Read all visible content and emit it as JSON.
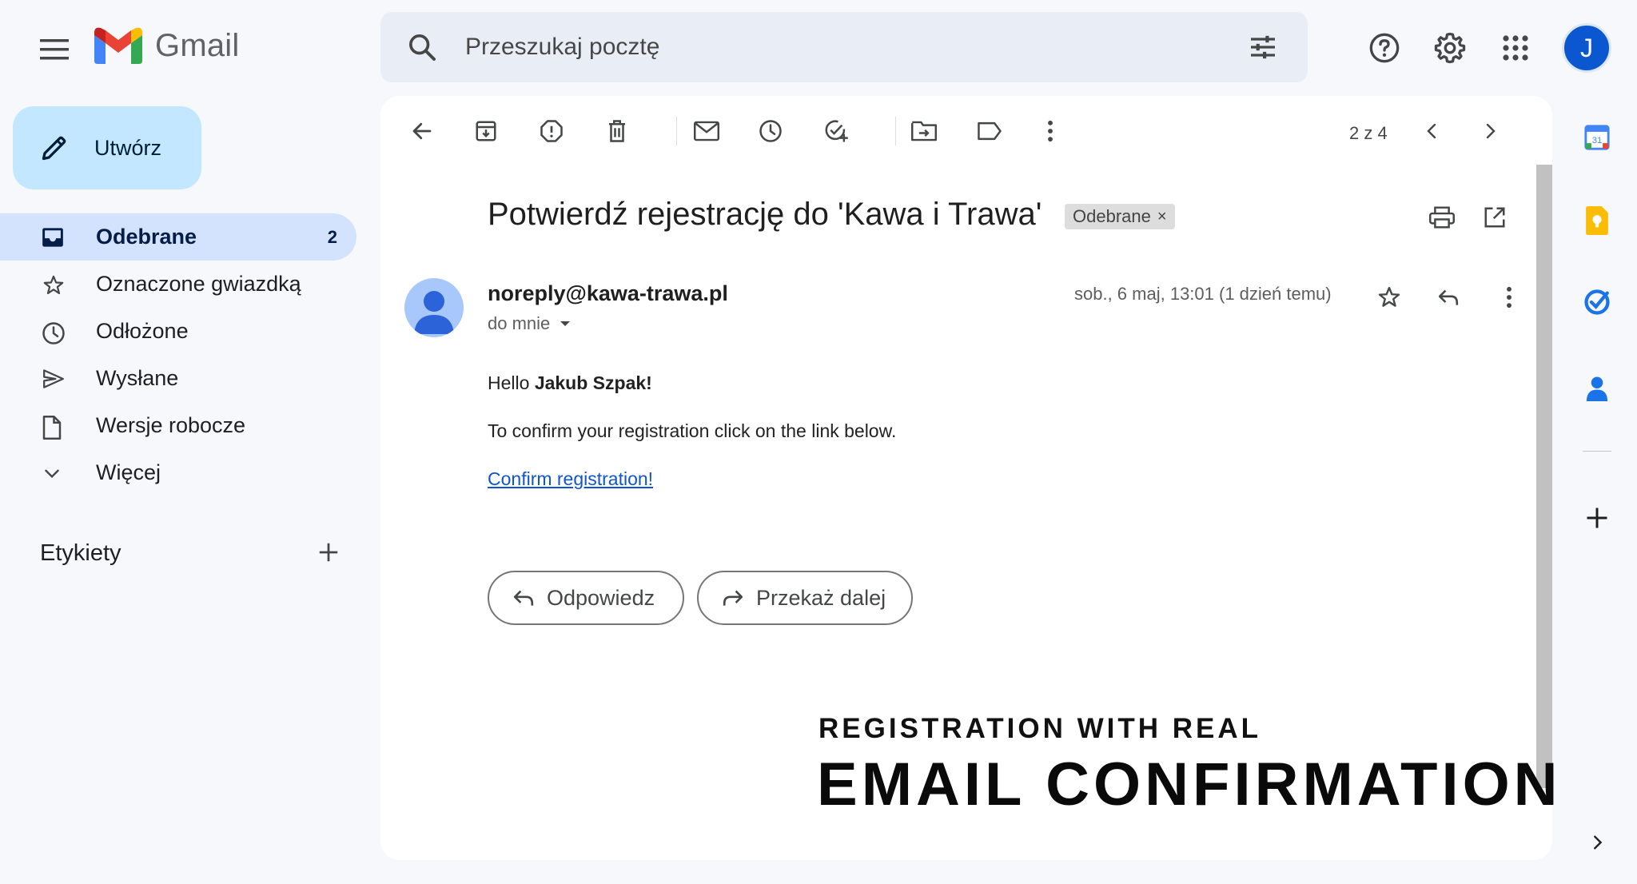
{
  "app": {
    "name": "Gmail",
    "brand_colors": {
      "red": "#ea4335",
      "blue": "#4285f4",
      "green": "#34a853",
      "yellow": "#fbbc04"
    }
  },
  "header": {
    "menu_icon": "hamburger-menu-icon",
    "search_placeholder": "Przeszukaj pocztę",
    "search_icon": "search-icon",
    "filter_icon": "tune-icon",
    "help_icon": "help-icon",
    "settings_icon": "gear-icon",
    "apps_icon": "apps-grid-icon",
    "avatar_letter": "J",
    "avatar_color": "#0b57d0"
  },
  "sidebar": {
    "compose_label": "Utwórz",
    "items": [
      {
        "label": "Odebrane",
        "count": "2",
        "icon": "inbox-icon",
        "active": true
      },
      {
        "label": "Oznaczone gwiazdką",
        "icon": "star-icon"
      },
      {
        "label": "Odłożone",
        "icon": "clock-icon"
      },
      {
        "label": "Wysłane",
        "icon": "send-icon"
      },
      {
        "label": "Wersje robocze",
        "icon": "draft-icon"
      },
      {
        "label": "Więcej",
        "icon": "chevron-down-icon"
      }
    ],
    "labels_heading": "Etykiety"
  },
  "toolbar": {
    "icons": [
      "back-arrow-icon",
      "archive-icon",
      "report-spam-icon",
      "delete-icon",
      "mark-unread-icon",
      "snooze-icon",
      "add-task-icon",
      "move-to-icon",
      "label-icon",
      "more-vert-icon"
    ],
    "pager_text": "2 z 4"
  },
  "message": {
    "subject": "Potwierdź rejestrację do 'Kawa i Trawa'",
    "label_chip": "Odebrane",
    "label_chip_close": "×",
    "sender": "noreply@kawa-trawa.pl",
    "recipient": "do mnie",
    "date": "sob., 6 maj, 13:01 (1 dzień temu)",
    "greeting_prefix": "Hello ",
    "greeting_name": "Jakub Szpak!",
    "body_line": "To confirm your registration click on the link below.",
    "link_text": "Confirm registration!",
    "link_color": "#1155cc",
    "reply_button": "Odpowiedz",
    "forward_button": "Przekaż dalej"
  },
  "overlay": {
    "line1": "REGISTRATION WITH REAL",
    "line2": "EMAIL CONFIRMATION"
  },
  "right_rail": {
    "calendar_day": "31",
    "icons": [
      "calendar-icon",
      "keep-icon",
      "tasks-icon",
      "contacts-icon",
      "add-icon",
      "chevron-right-icon"
    ]
  }
}
